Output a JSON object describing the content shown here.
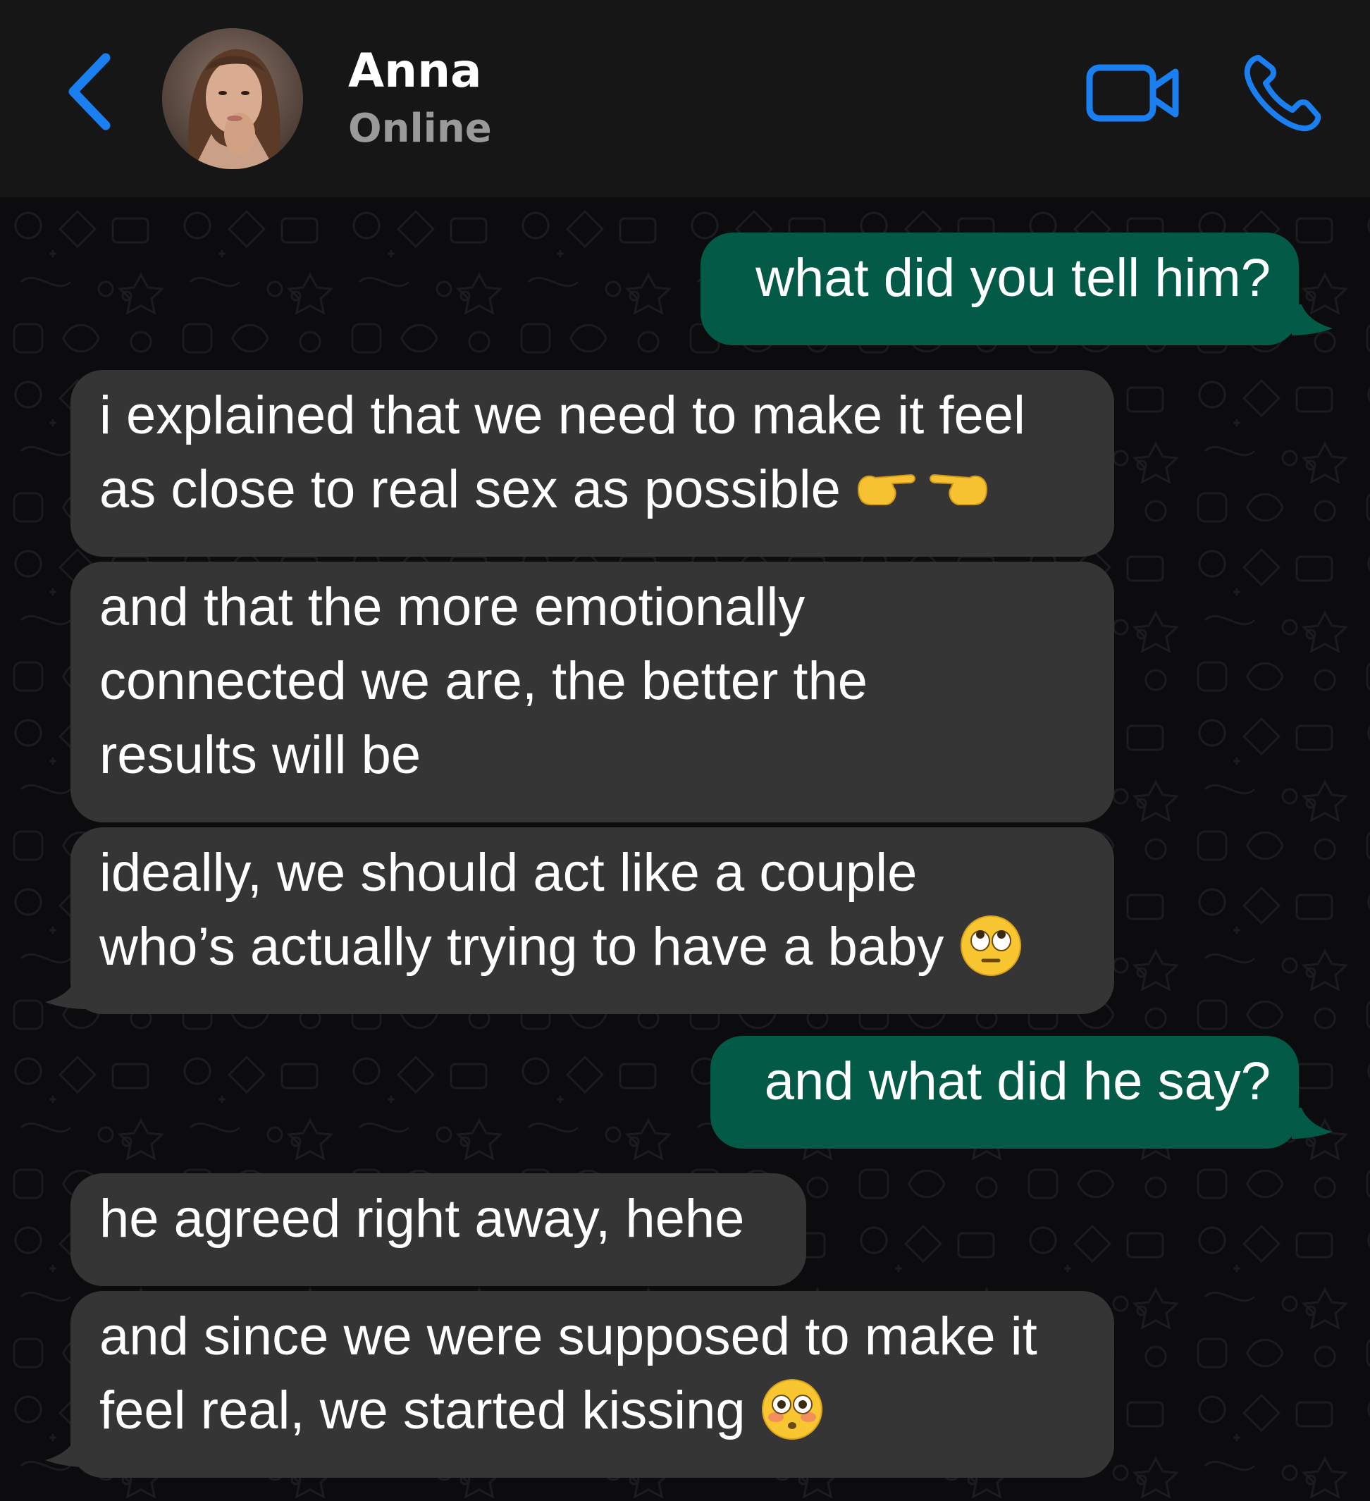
{
  "header": {
    "contact_name": "Anna",
    "status": "Online",
    "accent_color": "#1a7ff0"
  },
  "messages": [
    {
      "direction": "outgoing",
      "lines": [
        "what did you tell him?"
      ]
    },
    {
      "direction": "incoming",
      "lines": [
        "i explained that we need to make it feel",
        "as close to real sex as possible"
      ],
      "emoji": "pointing-hands-emoji"
    },
    {
      "direction": "incoming",
      "lines": [
        "and that the more emotionally",
        "connected we are, the better the",
        "results will be"
      ]
    },
    {
      "direction": "incoming",
      "lines": [
        "ideally, we should act like a couple",
        "who’s actually trying to have a baby"
      ],
      "emoji": "eye-roll-emoji"
    },
    {
      "direction": "outgoing",
      "lines": [
        "and what did he say?"
      ]
    },
    {
      "direction": "incoming",
      "lines": [
        "he agreed right away, hehe"
      ]
    },
    {
      "direction": "incoming",
      "lines": [
        "and since we were supposed to make it",
        "feel real, we started kissing"
      ],
      "emoji": "flushed-emoji"
    }
  ],
  "colors": {
    "outgoing_bubble": "#035a47",
    "incoming_bubble": "#353535",
    "header_bg": "#161616",
    "chat_bg": "#0c0c0e"
  }
}
